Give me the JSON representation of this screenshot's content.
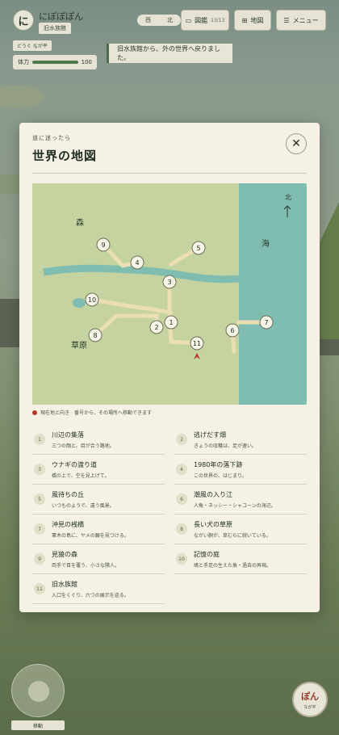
{
  "hud": {
    "avatar_glyph": "に",
    "player_name": "にぽぽぽん",
    "location": "旧水族館",
    "status": "どうぐ なが平",
    "hp_label": "体力",
    "hp_value": "100",
    "hp_fraction": 1.0,
    "compass_west": "西",
    "compass_north": "北",
    "zukan_label": "図鑑",
    "zukan_count": "13/13",
    "map_label": "地図",
    "menu_label": "メニュー"
  },
  "toast": "旧水族館から、外の世界へ戻りました。",
  "modal": {
    "subtitle": "道に迷ったら",
    "title": "世界の地図",
    "close_icon": "close-icon",
    "legend": "現在地と向き　番号から、その場所へ移動できます",
    "colors": {
      "land": "#c5d3a0",
      "sea": "#80bdb1",
      "river": "#80bdb1",
      "path": "#eadfb4",
      "marker": "#b13a2c"
    }
  },
  "map": {
    "forest_label": "森",
    "sea_label": "海",
    "grass_label": "草原",
    "north_label": "北",
    "markers": [
      {
        "num": "9"
      },
      {
        "num": "4"
      },
      {
        "num": "5"
      },
      {
        "num": "3"
      },
      {
        "num": "10"
      },
      {
        "num": "8"
      },
      {
        "num": "2"
      },
      {
        "num": "1"
      },
      {
        "num": "11"
      },
      {
        "num": "6"
      },
      {
        "num": "7"
      }
    ]
  },
  "places": [
    {
      "num": "1",
      "name": "川辺の集落",
      "desc": "三つの顔と、目が合う路地。"
    },
    {
      "num": "2",
      "name": "逃げだす畑",
      "desc": "きょうの収穫は、足が速い。"
    },
    {
      "num": "3",
      "name": "ウナギの渡り道",
      "desc": "橋の上で、空を見上げて。"
    },
    {
      "num": "4",
      "name": "1980年の落下跡",
      "desc": "この世界の、はじまり。"
    },
    {
      "num": "5",
      "name": "風待ちの丘",
      "desc": "いつものようで、違う風景。"
    },
    {
      "num": "6",
      "name": "潮風の入り江",
      "desc": "人魚・ネッシー・シャコーンの海辺。"
    },
    {
      "num": "7",
      "name": "沖見の桟橋",
      "desc": "軍木の島に、ヤメの願を見つける。"
    },
    {
      "num": "8",
      "name": "長い犬の草原",
      "desc": "ながい胴が、草むらに続いている。"
    },
    {
      "num": "9",
      "name": "見猿の森",
      "desc": "両手で目を覆う、小さな隣人。"
    },
    {
      "num": "10",
      "name": "記憶の庭",
      "desc": "鳩と手足の生えた魚・過去の再現。"
    },
    {
      "num": "11",
      "name": "旧水族館",
      "desc": "入口をくぐり、六つの展示を巡る。"
    }
  ],
  "controls": {
    "move_label": "移動",
    "action_main": "ぽん",
    "action_sub": "なが平"
  }
}
